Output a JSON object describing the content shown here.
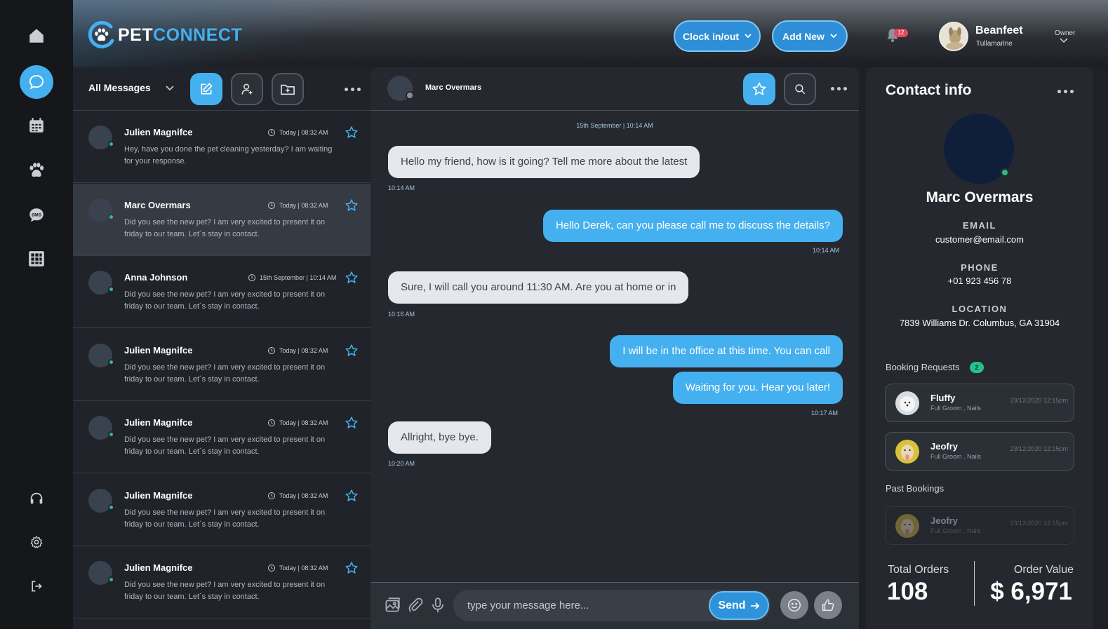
{
  "brand": {
    "name_part1": "PET",
    "name_part2": "CONNECT"
  },
  "header": {
    "clock_label": "Clock in/out",
    "add_new_label": "Add New",
    "notification_count": "12",
    "user_name": "Beanfeet",
    "user_subtitle": "Tullamarine",
    "user_role": "Owner"
  },
  "nav": {
    "items": [
      "home-icon",
      "chat-icon",
      "calendar-icon",
      "paw-icon",
      "sms-icon",
      "grid-icon",
      "headset-icon",
      "gear-icon",
      "logout-icon"
    ],
    "active": "chat-icon"
  },
  "message_list": {
    "filter_label": "All Messages",
    "conversations": [
      {
        "name": "Julien Magnifce",
        "time": "Today | 08:32 AM",
        "message": "Hey, have you done the pet cleaning yesterday? I am waiting for your response."
      },
      {
        "name": "Marc Overmars",
        "time": "Today | 08:32 AM",
        "message": "Did you see the new pet? I am very excited to present it on friday to our team. Let´s stay in contact."
      },
      {
        "name": "Anna Johnson",
        "time": "15th September | 10:14 AM",
        "message": "Did you see the new pet? I am very excited to present it on friday to our team. Let´s stay in contact."
      },
      {
        "name": "Julien Magnifce",
        "time": "Today | 08:32 AM",
        "message": "Did you see the new pet? I am very excited to present it on friday to our team. Let´s stay in contact."
      },
      {
        "name": "Julien Magnifce",
        "time": "Today | 08:32 AM",
        "message": "Did you see the new pet? I am very excited to present it on friday to our team. Let´s stay in contact."
      },
      {
        "name": "Julien Magnifce",
        "time": "Today | 08:32 AM",
        "message": "Did you see the new pet? I am very excited to present it on friday to our team. Let´s stay in contact."
      },
      {
        "name": "Julien Magnifce",
        "time": "Today | 08:32 AM",
        "message": "Did you see the new pet? I am very excited to present it on friday to our team. Let´s stay in contact."
      }
    ]
  },
  "chat": {
    "contact_name": "Marc Overmars",
    "date_separator": "15th September | 10:14 AM",
    "messages": [
      {
        "dir": "in",
        "text": "Hello my friend, how is it going? Tell me more about the latest",
        "time": "10:14 AM"
      },
      {
        "dir": "out",
        "text": "Hello Derek, can you please call me to discuss the details?",
        "time": "10:14 AM"
      },
      {
        "dir": "in",
        "text": "Sure, I will call you around 11:30 AM. Are you at home or in",
        "time": "10:16 AM"
      },
      {
        "dir": "out",
        "text": "I will be in the office at this time. You can call",
        "time": ""
      },
      {
        "dir": "out",
        "text": "Waiting for you. Hear you later!",
        "time": "10:17 AM"
      },
      {
        "dir": "in",
        "text": "Allright, bye bye.",
        "time": "10:20 AM"
      }
    ],
    "input_placeholder": "type your message here...",
    "send_label": "Send"
  },
  "contact": {
    "title": "Contact info",
    "name": "Marc Overmars",
    "email_label": "EMAIL",
    "email": "customer@email.com",
    "phone_label": "PHONE",
    "phone": "+01 923 456 78",
    "location_label": "LOCATION",
    "location": "7839 Williams Dr. Columbus, GA 31904",
    "booking_requests_label": "Booking Requests",
    "booking_requests_count": "2",
    "booking_requests": [
      {
        "pet": "Fluffy",
        "service": "Full Groom , Nails",
        "date": "23/12/2020 12:15pm"
      },
      {
        "pet": "Jeofry",
        "service": "Full Groom , Nails",
        "date": "23/12/2020 12:15pm"
      }
    ],
    "past_bookings_label": "Past Bookings",
    "past_bookings": [
      {
        "pet": "Jeofry",
        "service": "Full Groom , Nails",
        "date": "23/12/2020 12:15pm"
      }
    ],
    "total_orders_label": "Total Orders",
    "total_orders": "108",
    "order_value_label": "Order Value",
    "order_value": "$ 6,971"
  },
  "colors": {
    "accent": "#45b0f0",
    "online": "#27c08a",
    "panel": "#25282e",
    "badge": "#e2495b"
  }
}
